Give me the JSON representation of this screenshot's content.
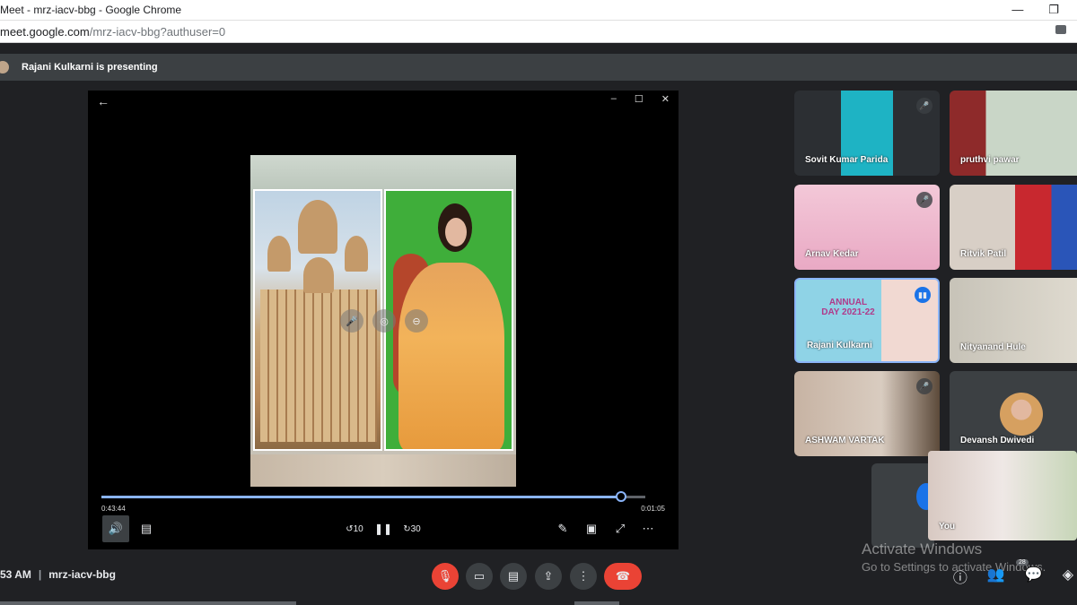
{
  "window": {
    "title": "Meet - mrz-iacv-bbg - Google Chrome",
    "minimize_glyph": "—",
    "restore_glyph": "❐"
  },
  "address": {
    "host": "meet.google.com",
    "path": "/mrz-iacv-bbg?authuser=0"
  },
  "presenting": {
    "text": "Rajani Kulkarni is presenting"
  },
  "player": {
    "back_glyph": "←",
    "minimize_glyph": "–",
    "maximize_glyph": "☐",
    "close_glyph": "✕",
    "current_time": "0:43:44",
    "end_time": "0:01:05",
    "progress_fraction": 0.955,
    "rewind_label": "10",
    "forward_label": "30"
  },
  "participants": [
    {
      "name": "Sovit Kumar Parida",
      "muted": true
    },
    {
      "name": "pruthvi pawar",
      "muted": false
    },
    {
      "name": "Arnav Kedar",
      "muted": true
    },
    {
      "name": "Ritvik Patil",
      "muted": false
    },
    {
      "name": "Rajani Kulkarni",
      "muted": false,
      "speaking": true
    },
    {
      "name": "Nityanand Hule",
      "muted": false
    },
    {
      "name": "ASHWAM VARTAK",
      "muted": true
    },
    {
      "name": "Devansh Dwivedi",
      "muted": false
    }
  ],
  "annual_day_text": "ANNUAL DAY 2021-22",
  "self_view": {
    "label": "You"
  },
  "meeting": {
    "time": "53 AM",
    "code": "mrz-iacv-bbg"
  },
  "people_count": "28",
  "watermark": {
    "line1": "Activate Windows",
    "line2": "Go to Settings to activate Windows."
  },
  "colors": {
    "accent_blue": "#8ab4f8",
    "danger_red": "#ea4335",
    "surface": "#3c4043",
    "background": "#202124"
  }
}
